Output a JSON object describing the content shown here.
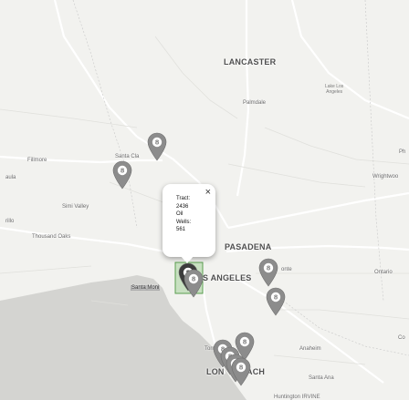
{
  "map": {
    "places": {
      "lancaster": "LANCASTER",
      "palmdale": "Palmdale",
      "lake_los_angeles_1": "Lake Los",
      "lake_los_angeles_2": "Angeles",
      "fillmore": "Fillmore",
      "paula": "aula",
      "santa_clarita": "Santa Cla",
      "simi_valley": "Simi Valley",
      "moorpark": "rillo",
      "thousand_oaks": "Thousand Oaks",
      "pasadena": "PASADENA",
      "los_angeles": "S ANGELES",
      "monrovia": "onte",
      "ontario": "Ontario",
      "santa_monica": "Santa Moni",
      "torrance": "Torranc",
      "long_beach_1": "LON",
      "long_beach_2": "ACH",
      "anaheim": "Anaheim",
      "santa_ana": "Santa Ana",
      "irvine": "Huntington   IRVINE",
      "phelan": "Ph",
      "wrightwood": "Wrightwoo",
      "corona": "Co"
    },
    "markers": [
      {
        "label": "8",
        "color": "#8c8c8c"
      },
      {
        "label": "8",
        "color": "#8c8c8c"
      },
      {
        "label": "8",
        "color": "#3c3c3c"
      },
      {
        "label": "8",
        "color": "#8c8c8c"
      },
      {
        "label": "8",
        "color": "#8c8c8c"
      },
      {
        "label": "8",
        "color": "#8c8c8c"
      },
      {
        "label": "8",
        "color": "#8c8c8c"
      },
      {
        "label": "8",
        "color": "#8c8c8c"
      },
      {
        "label": "8",
        "color": "#8c8c8c"
      },
      {
        "label": "8",
        "color": "#8c8c8c"
      },
      {
        "label": "8",
        "color": "#8c8c8c"
      }
    ],
    "selected_tract_color": "#7cbf6e"
  },
  "popup": {
    "close_glyph": "×",
    "line1": "Tract:",
    "line2": "2436",
    "line3": "Oil",
    "line4": "Wells:",
    "line5": "561"
  }
}
